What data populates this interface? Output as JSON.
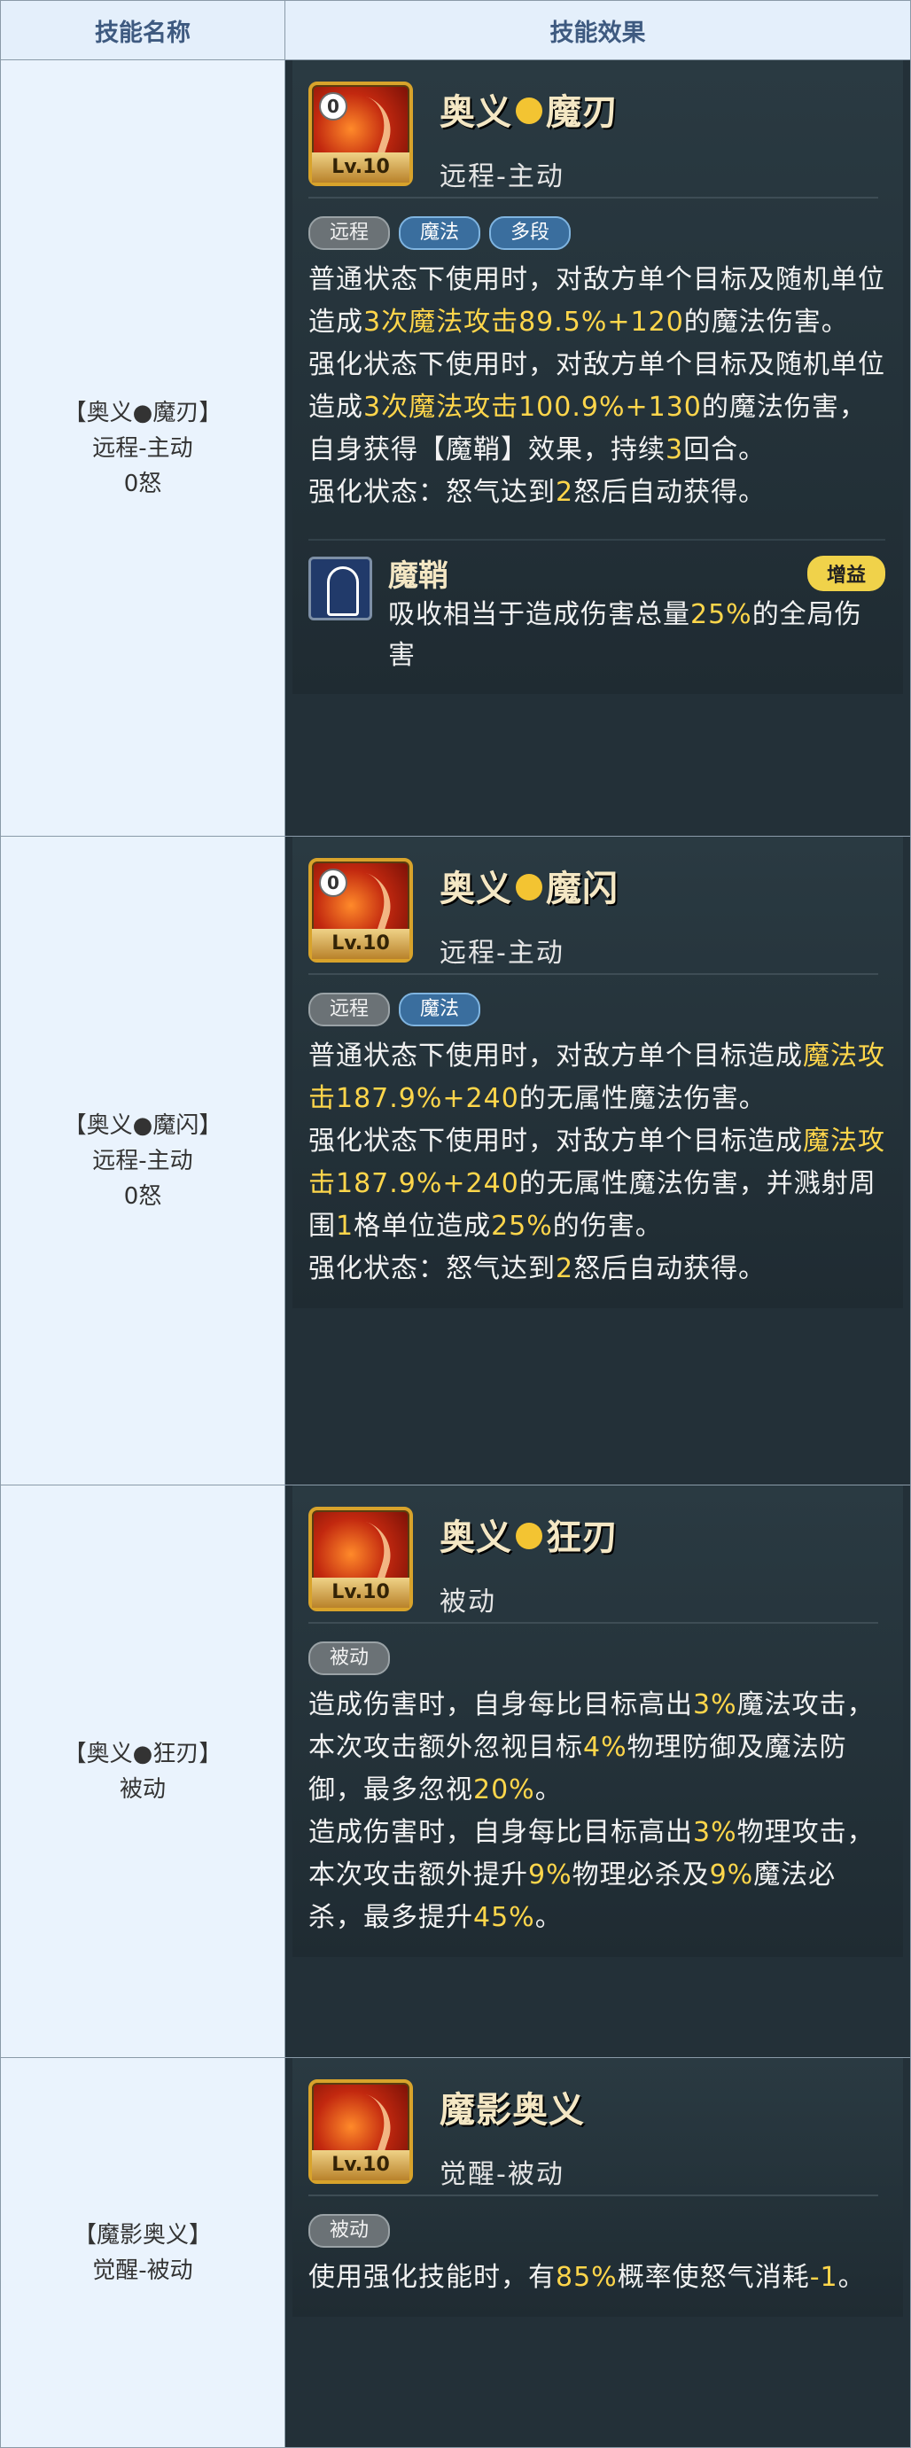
{
  "header": {
    "col_name": "技能名称",
    "col_effect": "技能效果"
  },
  "rows": [
    {
      "name": "【奥义●魔刃】",
      "type": "远程-主动",
      "rage": "0怒",
      "title_a": "奥义",
      "title_b": "魔刃",
      "cost": "0",
      "level": "Lv.10",
      "subtitle": "远程-主动",
      "tags": [
        "远程",
        "魔法",
        "多段"
      ],
      "desc": [
        [
          [
            "普通状态下使用时，对敌方单个目标及随机单位造成",
            false
          ],
          [
            "3次",
            true
          ],
          [
            "魔法攻击89.5%+120",
            true
          ],
          [
            "的魔法伤害。",
            false
          ]
        ],
        [
          [
            "强化状态下使用时，对敌方单个目标及随机单位造成",
            false
          ],
          [
            "3次",
            true
          ],
          [
            "魔法攻击100.9%+130",
            true
          ],
          [
            "的魔法伤害，自身获得【魔鞘】效果，持续",
            false
          ],
          [
            "3",
            true
          ],
          [
            "回合。",
            false
          ]
        ],
        [
          [
            "强化状态：怒气达到",
            false
          ],
          [
            "2",
            true
          ],
          [
            "怒后自动获得。",
            false
          ]
        ]
      ],
      "buff": {
        "name": "魔鞘",
        "badge": "增益",
        "desc_pre": "吸收相当于造成伤害总量",
        "desc_val": "25%",
        "desc_post": "的全局伤害"
      }
    },
    {
      "name": "【奥义●魔闪】",
      "type": "远程-主动",
      "rage": "0怒",
      "title_a": "奥义",
      "title_b": "魔闪",
      "cost": "0",
      "level": "Lv.10",
      "subtitle": "远程-主动",
      "tags": [
        "远程",
        "魔法"
      ],
      "desc": [
        [
          [
            "普通状态下使用时，对敌方单个目标造成",
            false
          ],
          [
            "魔法攻击187.9%+240",
            true
          ],
          [
            "的无属性魔法伤害。",
            false
          ]
        ],
        [
          [
            "强化状态下使用时，对敌方单个目标造成",
            false
          ],
          [
            "魔法攻击187.9%+240",
            true
          ],
          [
            "的无属性魔法伤害，并溅射周围",
            false
          ],
          [
            "1",
            true
          ],
          [
            "格单位造成",
            false
          ],
          [
            "25%",
            true
          ],
          [
            "的伤害。",
            false
          ]
        ],
        [
          [
            "强化状态：怒气达到",
            false
          ],
          [
            "2",
            true
          ],
          [
            "怒后自动获得。",
            false
          ]
        ]
      ]
    },
    {
      "name": "【奥义●狂刃】",
      "type": "被动",
      "title_a": "奥义",
      "title_b": "狂刃",
      "level": "Lv.10",
      "subtitle": "被动",
      "tags": [
        "被动"
      ],
      "desc": [
        [
          [
            "造成伤害时，自身每比目标高出",
            false
          ],
          [
            "3%",
            true
          ],
          [
            "魔法攻击，本次攻击额外忽视目标",
            false
          ],
          [
            "4%",
            true
          ],
          [
            "物理防御及魔法防御，最多忽视",
            false
          ],
          [
            "20%",
            true
          ],
          [
            "。",
            false
          ]
        ],
        [
          [
            "造成伤害时，自身每比目标高出",
            false
          ],
          [
            "3%",
            true
          ],
          [
            "物理攻击，本次攻击额外提升",
            false
          ],
          [
            "9%",
            true
          ],
          [
            "物理必杀及",
            false
          ],
          [
            "9%",
            true
          ],
          [
            "魔法必杀，最多提升",
            false
          ],
          [
            "45%",
            true
          ],
          [
            "。",
            false
          ]
        ]
      ]
    },
    {
      "name": "【魔影奥义】",
      "type": "觉醒-被动",
      "title_a": "魔影奥义",
      "level": "Lv.10",
      "subtitle": "觉醒-被动",
      "tags": [
        "被动"
      ],
      "desc": [
        [
          [
            "使用强化技能时，有",
            false
          ],
          [
            "85%",
            true
          ],
          [
            "概率使怒气消耗",
            false
          ],
          [
            "-1",
            true
          ],
          [
            "。",
            false
          ]
        ]
      ]
    }
  ],
  "colors": {
    "highlight": "#ffd64b",
    "panel": "#233038",
    "name_bg": "#eaf3fd"
  }
}
